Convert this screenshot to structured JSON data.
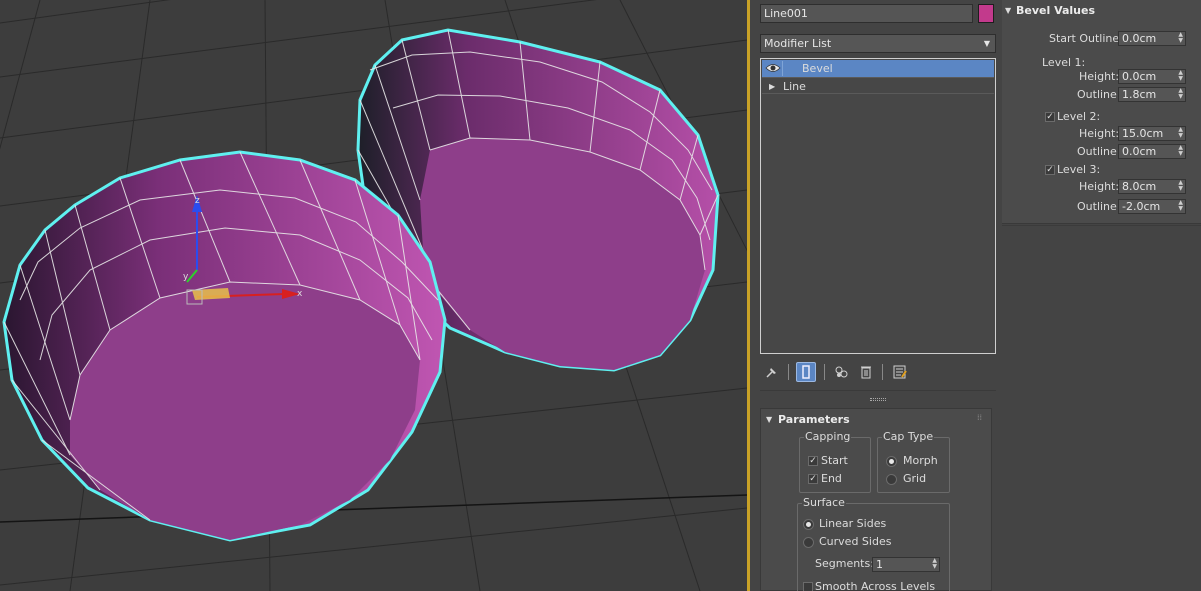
{
  "viewport": {
    "gizmo": {
      "x_axis_label": "x",
      "y_axis_label": "y",
      "z_axis_label": "z"
    }
  },
  "colors": {
    "object_color": "#c23a8c",
    "selection_highlight": "#5b86c4",
    "viewport_divider": "#c9a227",
    "selection_outline": "#5ff0f0"
  },
  "object_name": "Line001",
  "modifier_list": {
    "label": "Modifier List"
  },
  "modifier_stack": {
    "items": [
      {
        "label": "Bevel",
        "selected": true,
        "icon": "eye-icon"
      },
      {
        "label": "Line",
        "selected": false,
        "icon": "expand-triangle-icon"
      }
    ]
  },
  "stack_tools": {
    "icons": [
      "pin-stack-icon",
      "show-end-result-icon",
      "make-unique-icon",
      "remove-modifier-icon",
      "configure-modifier-sets-icon"
    ]
  },
  "parameters": {
    "title": "Parameters",
    "capping": {
      "label": "Capping",
      "start_label": "Start",
      "start_checked": true,
      "end_label": "End",
      "end_checked": true
    },
    "cap_type": {
      "label": "Cap Type",
      "morph_label": "Morph",
      "grid_label": "Grid",
      "selected": "Morph"
    },
    "surface": {
      "label": "Surface",
      "linear_label": "Linear Sides",
      "curved_label": "Curved Sides",
      "selected": "Linear Sides",
      "segments_label": "Segments:",
      "segments_value": "1",
      "smooth_label": "Smooth Across Levels"
    }
  },
  "bevel_values": {
    "title": "Bevel Values",
    "start_outline_label": "Start Outline:",
    "start_outline_value": "0.0cm",
    "level1": {
      "label": "Level 1:",
      "height_label": "Height:",
      "height_value": "0.0cm",
      "outline_label": "Outline:",
      "outline_value": "1.8cm"
    },
    "level2": {
      "label": "Level 2:",
      "checked": true,
      "height_label": "Height:",
      "height_value": "15.0cm",
      "outline_label": "Outline:",
      "outline_value": "0.0cm"
    },
    "level3": {
      "label": "Level 3:",
      "checked": true,
      "height_label": "Height:",
      "height_value": "8.0cm",
      "outline_label": "Outline:",
      "outline_value": "-2.0cm"
    }
  }
}
